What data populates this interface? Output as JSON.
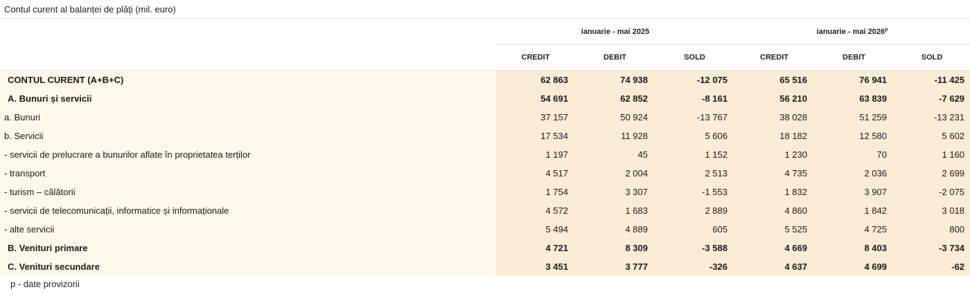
{
  "title": "Contul curent al balanței de plăți (mil. euro)",
  "periods": [
    {
      "label": "ianuarie - mai 2025",
      "sup": ""
    },
    {
      "label": "ianuarie - mai 2026",
      "sup": "p"
    }
  ],
  "columns": [
    "CREDIT",
    "DEBIT",
    "SOLD",
    "CREDIT",
    "DEBIT",
    "SOLD"
  ],
  "rows": [
    {
      "label": "CONTUL CURENT (A+B+C)",
      "values": [
        "62 863",
        "74 938",
        "-12 075",
        "65 516",
        "76 941",
        "-11 425"
      ]
    },
    {
      "label": "A. Bunuri și servicii",
      "values": [
        "54 691",
        "62 852",
        "-8 161",
        "56 210",
        "63 839",
        "-7 629"
      ]
    },
    {
      "label": "a. Bunuri",
      "values": [
        "37 157",
        "50 924",
        "-13 767",
        "38 028",
        "51 259",
        "-13 231"
      ]
    },
    {
      "label": "b. Servicii",
      "values": [
        "17 534",
        "11 928",
        "5 606",
        "18 182",
        "12 580",
        "5 602"
      ]
    },
    {
      "label": "-  servicii de prelucrare a bunurilor aflate în proprietatea terților",
      "values": [
        "1 197",
        "45",
        "1 152",
        "1 230",
        "70",
        "1 160"
      ]
    },
    {
      "label": "- transport",
      "values": [
        "4 517",
        "2 004",
        "2 513",
        "4 735",
        "2 036",
        "2 699"
      ]
    },
    {
      "label": "- turism – călătorii",
      "values": [
        "1 754",
        "3 307",
        "-1 553",
        "1 832",
        "3 907",
        "-2 075"
      ]
    },
    {
      "label": "-  servicii de telecomunicații, informatice și informaționale",
      "values": [
        "4 572",
        "1 683",
        "2 889",
        "4 860",
        "1 842",
        "3 018"
      ]
    },
    {
      "label": "- alte servicii",
      "values": [
        "5 494",
        "4 889",
        "605",
        "5 525",
        "4 725",
        "800"
      ]
    },
    {
      "label": "B. Venituri primare",
      "values": [
        "4 721",
        "8 309",
        "-3 588",
        "4 669",
        "8 403",
        "-3 734"
      ]
    },
    {
      "label": "C. Venituri secundare",
      "values": [
        "3 451",
        "3 777",
        "-326",
        "4 637",
        "4 699",
        "-62"
      ]
    }
  ],
  "footnote": "p - date provizorii"
}
